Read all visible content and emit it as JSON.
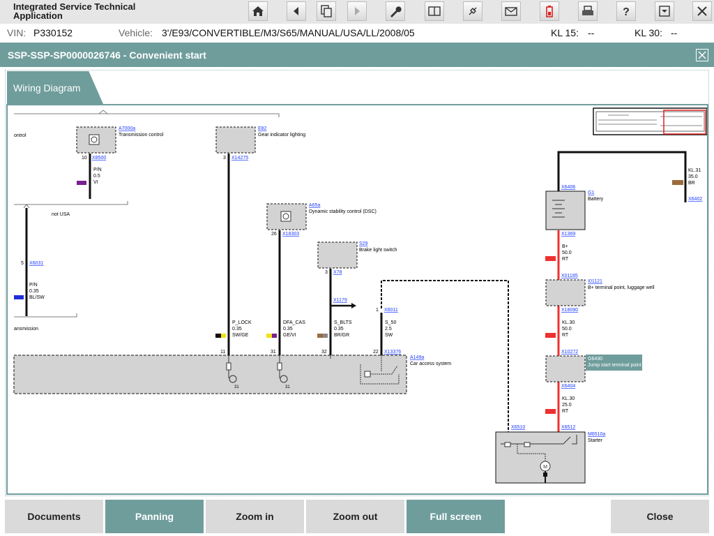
{
  "app": {
    "title_line1": "Integrated Service Technical",
    "title_line2": "Application"
  },
  "toolbar_icons": [
    "home-icon",
    "back-icon",
    "copy-pages-icon",
    "forward-icon",
    "wrench-icon",
    "compare-icon",
    "plug-icon",
    "mail-icon",
    "battery-icon",
    "printer-icon",
    "help-icon",
    "download-icon",
    "close-icon"
  ],
  "vehicle_bar": {
    "vin_label": "VIN:",
    "vin_value": "P330152",
    "vehicle_label": "Vehicle:",
    "vehicle_value": "3'/E93/CONVERTIBLE/M3/S65/MANUAL/USA/LL/2008/05",
    "kl15_label": "KL 15:",
    "kl15_value": "--",
    "kl30_label": "KL 30:",
    "kl30_value": "--"
  },
  "document": {
    "title": "SSP-SSP-SP0000026746  -  Convenient start",
    "tab_label": "Wiring Diagram"
  },
  "diagram": {
    "texts": {
      "ontrol": "ontrol",
      "a7000a": "A7000a",
      "trans_ctrl": "Transmission control",
      "pin10": "10",
      "x8500": "X8500",
      "pn": "P/N",
      "p5": "0.5",
      "vi": "VI",
      "e82": "E82",
      "gear_light": "Gear indicator lighting",
      "pin3": "3",
      "x14275": "X14275",
      "not_usa": "not USA",
      "a65a": "A65a",
      "dsc": "Dynamic stability control (DSC)",
      "pin26": "26",
      "x18303": "X18303",
      "s29": "S29",
      "brake": "Brake light switch",
      "pin3b": "3",
      "x78": "X78",
      "x1179": "X1179",
      "pin1": "1",
      "x6011": "X6011",
      "pin5": "5",
      "x6031": "X6031",
      "pn2": "P/N",
      "p35": "0.35",
      "blsw": "BL/SW",
      "ansmission": "ansmission",
      "plock": "P_LOCK",
      "p35b": "0.35",
      "swge": "SW/GE",
      "dfacas": "DFA_CAS",
      "p35c": "0.35",
      "gevi": "GE/VI",
      "sblts": "S_BLTS",
      "p35d": "0.35",
      "brgr": "BR/GR",
      "s50": "S_50",
      "p25": "2.5",
      "sw": "SW",
      "pin11": "11",
      "pin31": "31",
      "pin32": "32",
      "pin22": "22",
      "x13376": "X13376",
      "a149a": "A149a",
      "cas": "Car access system",
      "g31a": "31",
      "g31b": "31",
      "x6406": "X6406",
      "g1": "G1",
      "battery": "Battery",
      "x6402": "X6402",
      "kl31": "KL.31",
      "p350": "35.0",
      "br": "BR",
      "x1369": "X1369",
      "bplus": "B+",
      "p500": "50.0",
      "rt1": "RT",
      "x01185": "X01185",
      "i01121": "I01121",
      "bterm": "B+ terminal point, luggage well",
      "x18090": "X18090",
      "kl30a": "KL.30",
      "p500b": "50.0",
      "rt2": "RT",
      "x10272": "X10272",
      "g6430": "G6430",
      "jump": "Jump start terminal point",
      "x6404": "X6404",
      "kl30b": "KL.30",
      "p250": "25.0",
      "rt3": "RT",
      "x6510": "X6510",
      "x6512": "X6512",
      "m6510a": "M6510a",
      "starter": "Starter"
    }
  },
  "bottom_buttons": {
    "documents": "Documents",
    "panning": "Panning",
    "zoom_in": "Zoom in",
    "zoom_out": "Zoom out",
    "full_screen": "Full screen",
    "close": "Close"
  },
  "colors": {
    "teal": "#6f9d9c",
    "wire_red": "#ef3030",
    "purple": "#7a1f8f",
    "blue": "#1f2fd8",
    "yellow": "#f2e11a",
    "brown": "#9c6b3c"
  }
}
